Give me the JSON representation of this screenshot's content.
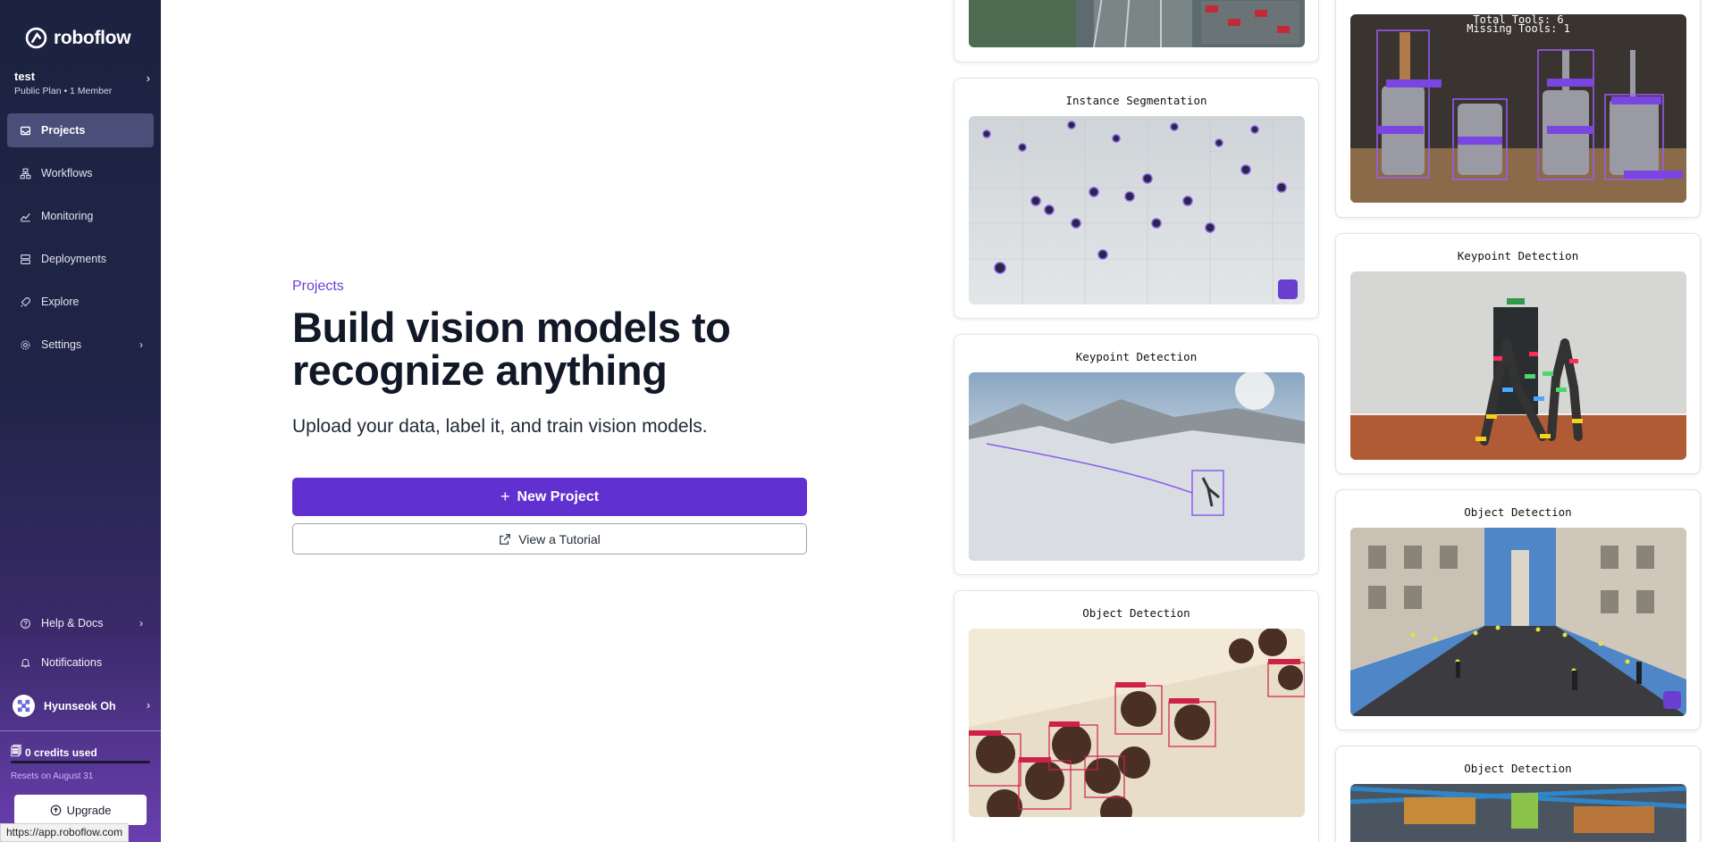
{
  "app": {
    "name": "roboflow"
  },
  "workspace": {
    "name": "test",
    "plan": "Public Plan • 1 Member"
  },
  "nav": {
    "items": [
      {
        "label": "Projects",
        "icon": "inbox-icon",
        "active": true
      },
      {
        "label": "Workflows",
        "icon": "workflow-icon"
      },
      {
        "label": "Monitoring",
        "icon": "chart-icon"
      },
      {
        "label": "Deployments",
        "icon": "server-icon"
      },
      {
        "label": "Explore",
        "icon": "rocket-icon"
      },
      {
        "label": "Settings",
        "icon": "gear-icon"
      }
    ]
  },
  "bottom_nav": {
    "help": "Help & Docs",
    "notifications": "Notifications"
  },
  "user": {
    "name": "Hyunseok Oh"
  },
  "credits": {
    "used_label": "0 credits used",
    "resets": "Resets on August 31"
  },
  "upgrade_label": "Upgrade",
  "status_url": "https://app.roboflow.com",
  "main": {
    "eyebrow": "Projects",
    "title": "Build vision models to recognize anything",
    "subtitle": "Upload your data, label it, and train vision models.",
    "new_project": "New Project",
    "tutorial": "View a Tutorial"
  },
  "gallery": {
    "col1": [
      {
        "title": "Instance Segmentation"
      },
      {
        "title": "Keypoint Detection"
      },
      {
        "title": "Object Detection"
      }
    ],
    "col2": [
      {
        "title": "Keypoint Detection"
      },
      {
        "title": "Object Detection"
      },
      {
        "title": "Object Detection"
      }
    ],
    "tools_overlay": [
      "Total Tools: 6",
      "Missing Tools: 1"
    ]
  },
  "colors": {
    "accent": "#6030d0",
    "eyebrow": "#6b3fd4"
  }
}
